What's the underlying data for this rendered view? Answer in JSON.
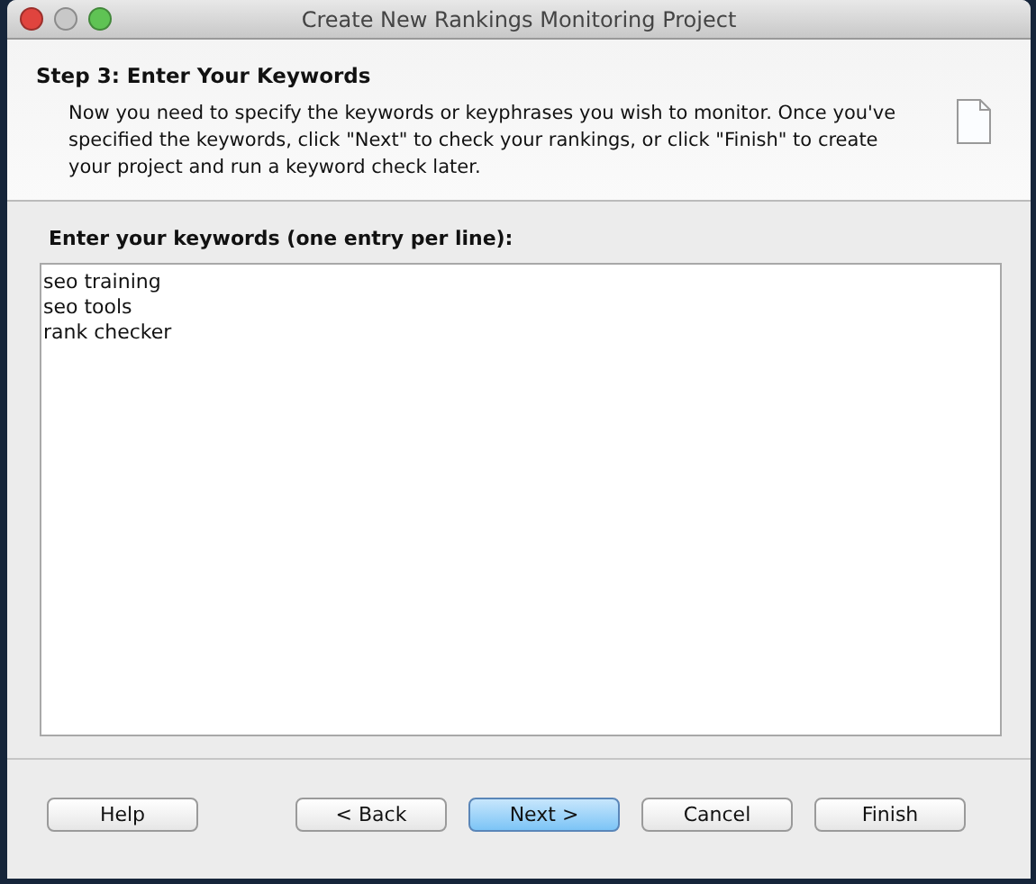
{
  "window": {
    "title": "Create New Rankings Monitoring Project"
  },
  "header": {
    "title": "Step 3: Enter Your Keywords",
    "description": "Now you need to specify the keywords or keyphrases you wish to monitor. Once you've specified the keywords, click \"Next\" to check your rankings, or click \"Finish\" to create your project and run a keyword check later."
  },
  "keywords": {
    "label": "Enter your keywords (one entry per line):",
    "value": "seo training\nseo tools\nrank checker"
  },
  "buttons": [
    {
      "label": "Help",
      "default": false
    },
    {
      "label": "< Back",
      "default": false
    },
    {
      "label": "Next >",
      "default": true
    },
    {
      "label": "Cancel",
      "default": false
    },
    {
      "label": "Finish",
      "default": false
    }
  ]
}
